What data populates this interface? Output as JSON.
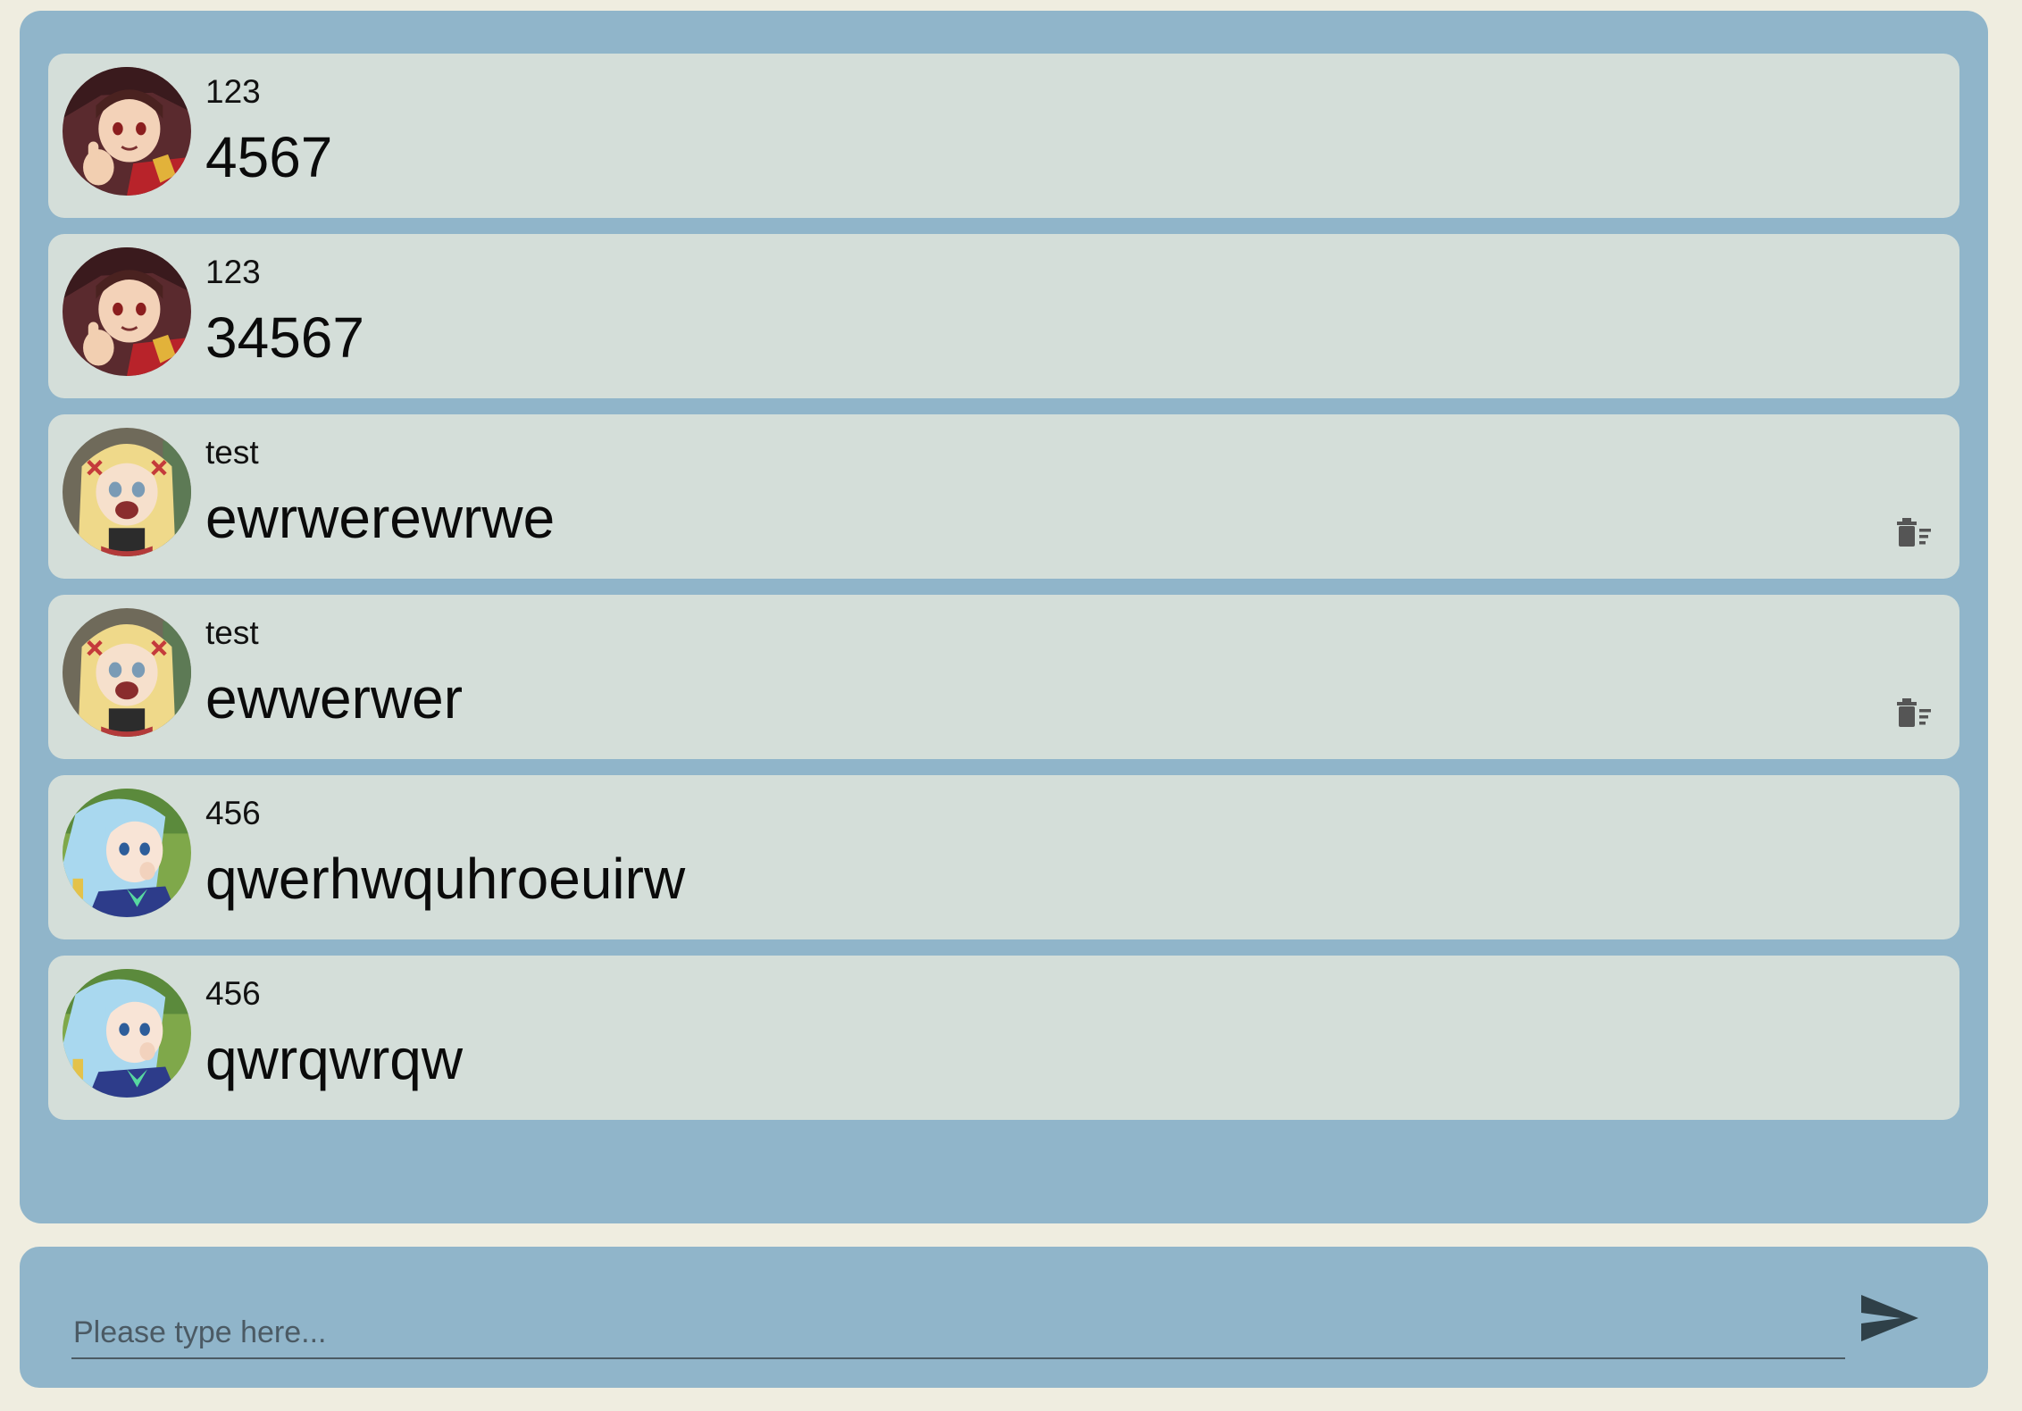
{
  "messages": [
    {
      "username": "123",
      "text": "4567",
      "avatar": "avatar-red-hat-girl",
      "deletable": false
    },
    {
      "username": "123",
      "text": "34567",
      "avatar": "avatar-red-hat-girl",
      "deletable": false
    },
    {
      "username": "test",
      "text": "ewrwerewrwe",
      "avatar": "avatar-blonde-girl",
      "deletable": true
    },
    {
      "username": "test",
      "text": "ewwerwer",
      "avatar": "avatar-blonde-girl",
      "deletable": true
    },
    {
      "username": "456",
      "text": "qwerhwquhroeuirw",
      "avatar": "avatar-blue-hair-girl",
      "deletable": false
    },
    {
      "username": "456",
      "text": "qwrqwrqw",
      "avatar": "avatar-blue-hair-girl",
      "deletable": false
    }
  ],
  "composer": {
    "placeholder": "Please type here...",
    "value": "",
    "send_icon": "send-icon"
  },
  "colors": {
    "page_background": "#efede0",
    "panel": "#90b5ca",
    "message_card": "#d4ded9"
  }
}
